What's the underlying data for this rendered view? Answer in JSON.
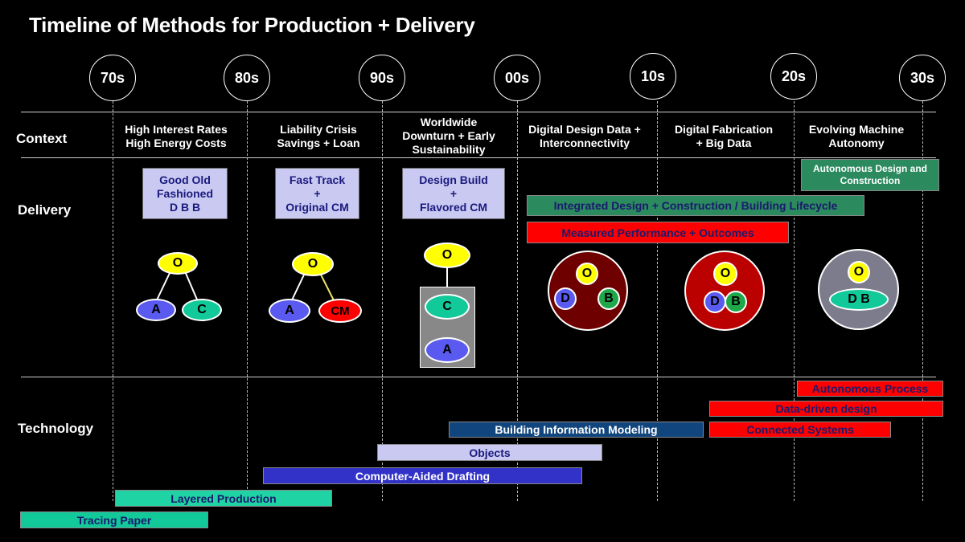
{
  "title": "Timeline of Methods for Production + Delivery",
  "decades": [
    "70s",
    "80s",
    "90s",
    "00s",
    "10s",
    "20s",
    "30s"
  ],
  "rows": {
    "context": "Context",
    "delivery": "Delivery",
    "technology": "Technology"
  },
  "context": {
    "c70": [
      "High Interest Rates",
      "High Energy Costs"
    ],
    "c80": [
      "Liability Crisis",
      "Savings + Loan"
    ],
    "c90": [
      "Worldwide",
      "Downturn + Early",
      "Sustainability"
    ],
    "c00": [
      "Digital Design Data +",
      "Interconnectivity"
    ],
    "c10": [
      "Digital Fabrication",
      "+ Big Data"
    ],
    "c20": [
      "Evolving Machine",
      "Autonomy"
    ]
  },
  "delivery": {
    "dbb": [
      "Good Old",
      "Fashioned",
      "D B B"
    ],
    "fast": [
      "Fast Track",
      "+",
      "Original CM"
    ],
    "db": [
      "Design Build",
      "+",
      "Flavored CM"
    ],
    "autonomous": "Autonomous Design and Construction",
    "integrated": "Integrated Design + Construction / Building Lifecycle",
    "measured": "Measured Performance + Outcomes"
  },
  "nodes": {
    "o": "O",
    "a": "A",
    "c": "C",
    "cm": "CM",
    "d": "D",
    "b": "B",
    "db": "D B"
  },
  "technology": {
    "autonomous_process": "Autonomous Process",
    "data_driven": "Data-driven design",
    "connected": "Connected Systems",
    "bim": "Building Information Modeling",
    "objects": "Objects",
    "cad": "Computer-Aided Drafting",
    "layered": "Layered Production",
    "tracing": "Tracing Paper"
  },
  "colors": {
    "background": "#000000",
    "lavender": "#c9c9f2",
    "teal": "#12c99a",
    "green": "#2b8a5e",
    "red": "#ff0000",
    "navy": "#11457e",
    "blue": "#3232c8",
    "yellow": "#ffff00",
    "dark_red": "#6e0000",
    "gray": "#7c7c8c"
  }
}
